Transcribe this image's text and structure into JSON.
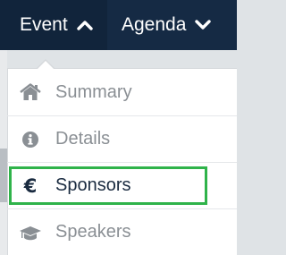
{
  "navbar": {
    "event_label": "Event",
    "agenda_label": "Agenda"
  },
  "menu": {
    "items": [
      {
        "label": "Summary",
        "icon": "home-icon"
      },
      {
        "label": "Details",
        "icon": "info-icon"
      },
      {
        "label": "Sponsors",
        "icon": "euro-icon",
        "icon_glyph": "€",
        "selected": true
      },
      {
        "label": "Speakers",
        "icon": "graduation-cap-icon"
      }
    ]
  },
  "colors": {
    "navbar": "#152a44",
    "highlight": "#2fb34a",
    "muted_text": "#8a8f94",
    "active_text": "#1a2b40"
  }
}
